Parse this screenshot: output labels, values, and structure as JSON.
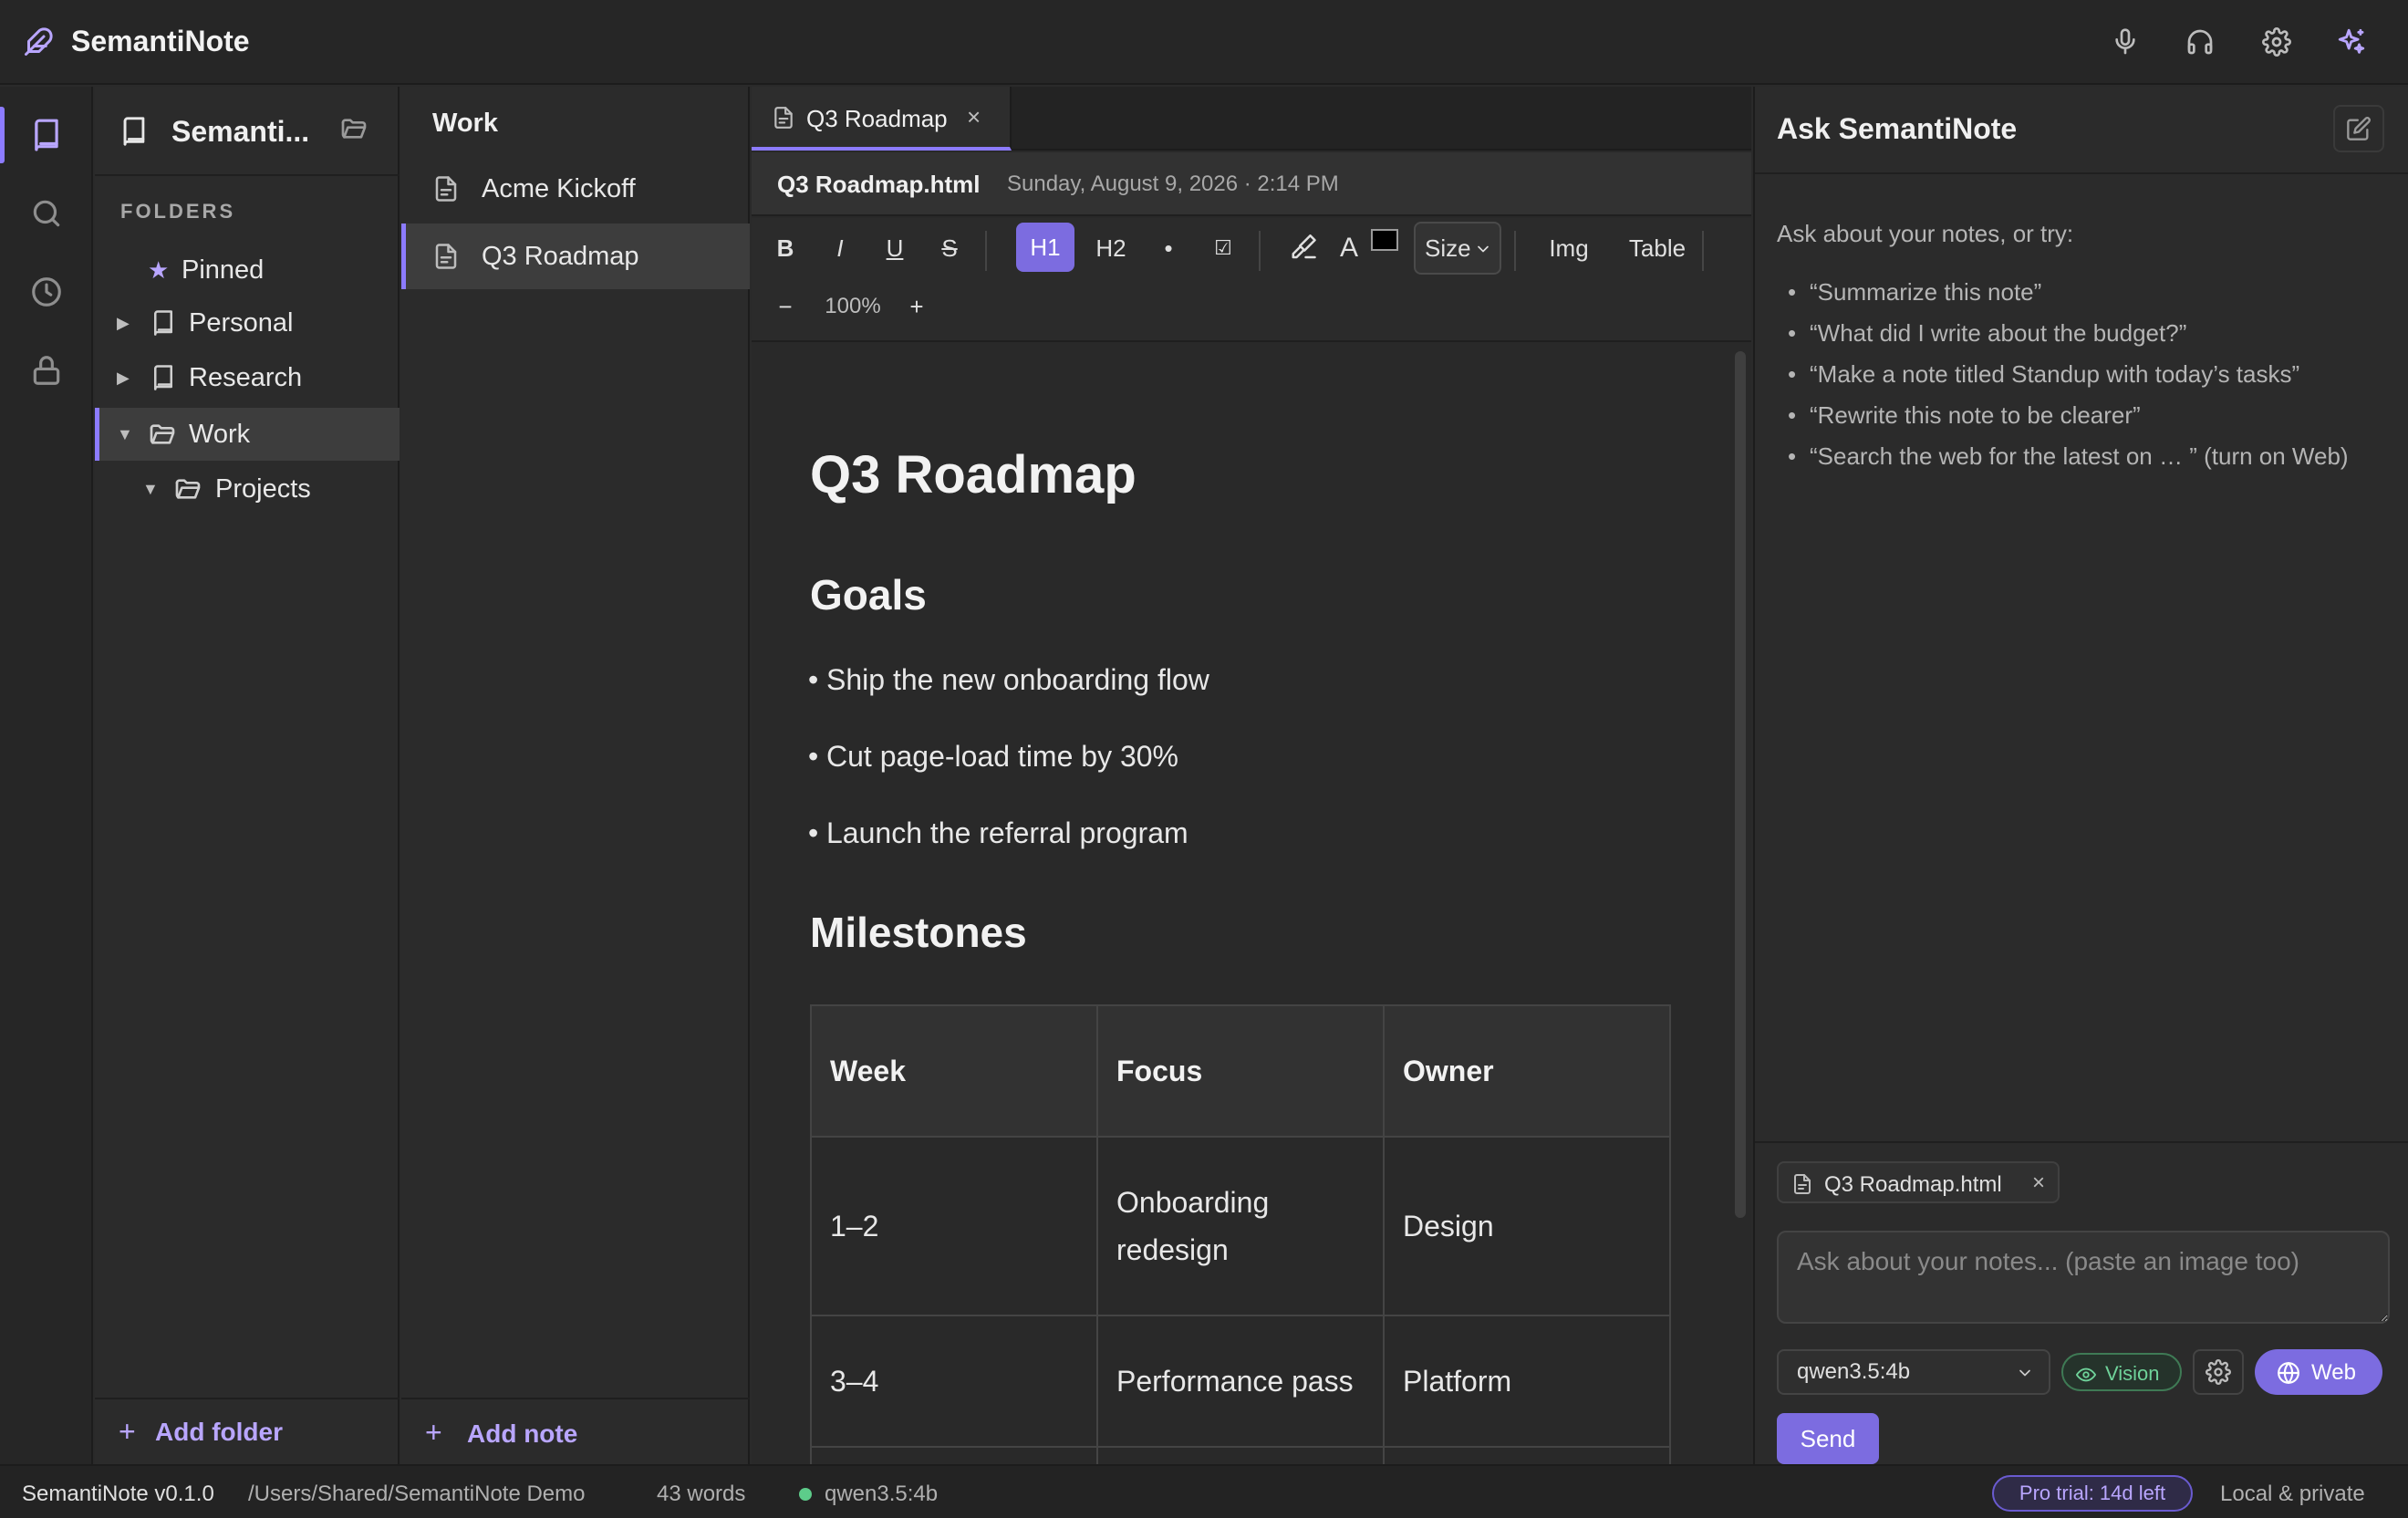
{
  "app": {
    "title": "SemantiNote",
    "accent": "#8c7bff"
  },
  "titlebar": {
    "icons": [
      "microphone-icon",
      "headphones-icon",
      "settings-gear-icon",
      "ai-sparkle-icon"
    ]
  },
  "rail": {
    "items": [
      "notebook-icon",
      "search-icon",
      "history-clock-icon",
      "lock-icon"
    ],
    "active": "notebook-icon"
  },
  "folders": {
    "notebook_title": "Semanti...",
    "section_label": "FOLDERS",
    "items": [
      {
        "label": "Pinned",
        "icon": "star-icon"
      },
      {
        "label": "Personal",
        "icon": "notebook-icon"
      },
      {
        "label": "Research",
        "icon": "notebook-icon"
      },
      {
        "label": "Work",
        "icon": "folder-open-icon"
      },
      {
        "label": "Projects",
        "icon": "folder-icon"
      }
    ],
    "selected": "Work",
    "add_label": "Add folder"
  },
  "notes": {
    "title": "Work",
    "items": [
      {
        "label": "Acme Kickoff"
      },
      {
        "label": "Q3 Roadmap"
      }
    ],
    "selected": "Q3 Roadmap",
    "add_label": "Add note"
  },
  "editor": {
    "tab": {
      "label": "Q3 Roadmap",
      "close": "×"
    },
    "file_name": "Q3 Roadmap.html",
    "file_date": "Sunday, August 9, 2026 · 2:14 PM",
    "toolbar": {
      "bold": "B",
      "italic": "I",
      "underline": "U",
      "strike": "S",
      "h1": "H1",
      "h2": "H2",
      "bullet": "•",
      "checkbox": "☑",
      "text_color_label": "A",
      "text_color_value": "#000000",
      "size": "Size",
      "img": "Img",
      "table": "Table",
      "zoom_out": "−",
      "zoom": "100%",
      "zoom_in": "+"
    },
    "doc": {
      "h1": "Q3 Roadmap",
      "goals_heading": "Goals",
      "goals": [
        "Ship the new onboarding flow",
        "Cut page-load time by 30%",
        "Launch the referral program"
      ],
      "milestones_heading": "Milestones",
      "table": {
        "headers": [
          "Week",
          "Focus",
          "Owner"
        ],
        "rows": [
          [
            "1–2",
            "Onboarding redesign",
            "Design"
          ],
          [
            "3–4",
            "Performance pass",
            "Platform"
          ],
          [
            "",
            "",
            ""
          ]
        ]
      }
    }
  },
  "assistant": {
    "title": "Ask SemantiNote",
    "intro": "Ask about your notes, or try:",
    "suggestions": [
      "“Summarize this note”",
      "“What did I write about the budget?”",
      "“Make a note titled Standup with today’s tasks”",
      "“Rewrite this note to be clearer”",
      "“Search the web for the latest on … ” (turn on Web)"
    ],
    "context_chip": "Q3 Roadmap.html",
    "context_close": "×",
    "input_placeholder": "Ask about your notes... (paste an image too)",
    "model": "qwen3.5:4b",
    "vision_label": "Vision",
    "web_label": "Web",
    "send_label": "Send"
  },
  "status": {
    "version": "SemantiNote v0.1.0",
    "path": "/Users/Shared/SemantiNote Demo",
    "words": "43 words",
    "model": "qwen3.5:4b",
    "model_status_color": "#5dcc8a",
    "pro": "Pro trial: 14d left",
    "privacy": "Local & private"
  }
}
